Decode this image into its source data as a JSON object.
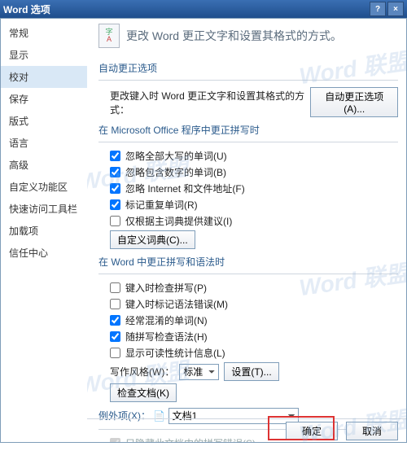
{
  "window": {
    "title": "Word 选项"
  },
  "sidebar": {
    "items": [
      "常规",
      "显示",
      "校对",
      "保存",
      "版式",
      "语言",
      "高级",
      "自定义功能区",
      "快速访问工具栏",
      "加载项",
      "信任中心"
    ]
  },
  "header": {
    "title": "更改 Word 更正文字和设置其格式的方式。"
  },
  "sec_autocorrect": {
    "title": "自动更正选项",
    "row_label": "更改键入时 Word 更正文字和设置其格式的方式：",
    "btn": "自动更正选项(A)..."
  },
  "sec_office": {
    "title": "在 Microsoft Office 程序中更正拼写时",
    "cb_uppercase": "忽略全部大写的单词(U)",
    "cb_numbers": "忽略包含数字的单词(B)",
    "cb_internet": "忽略 Internet 和文件地址(F)",
    "cb_repeated": "标记重复单词(R)",
    "cb_mainsuggest": "仅根据主词典提供建议(I)",
    "btn_custom_dict": "自定义词典(C)..."
  },
  "sec_word": {
    "title": "在 Word 中更正拼写和语法时",
    "cb_spell_as_type": "键入时检查拼写(P)",
    "cb_grammar_as_type": "键入时标记语法错误(M)",
    "cb_confused": "经常混淆的单词(N)",
    "cb_grammar_with_spell": "随拼写检查语法(H)",
    "cb_readability": "显示可读性统计信息(L)",
    "writing_style_label": "写作风格(W)：",
    "writing_style_value": "标准",
    "btn_settings": "设置(T)...",
    "btn_check_document": "检查文档(K)"
  },
  "sec_exceptions": {
    "title_prefix": "例外项(X)：",
    "doc_value": "文档1",
    "cb_hide_spell": "只隐藏此文档中的拼写错误(S)"
  },
  "footer": {
    "ok": "确定",
    "cancel": "取消"
  },
  "watermark": "Word 联盟"
}
